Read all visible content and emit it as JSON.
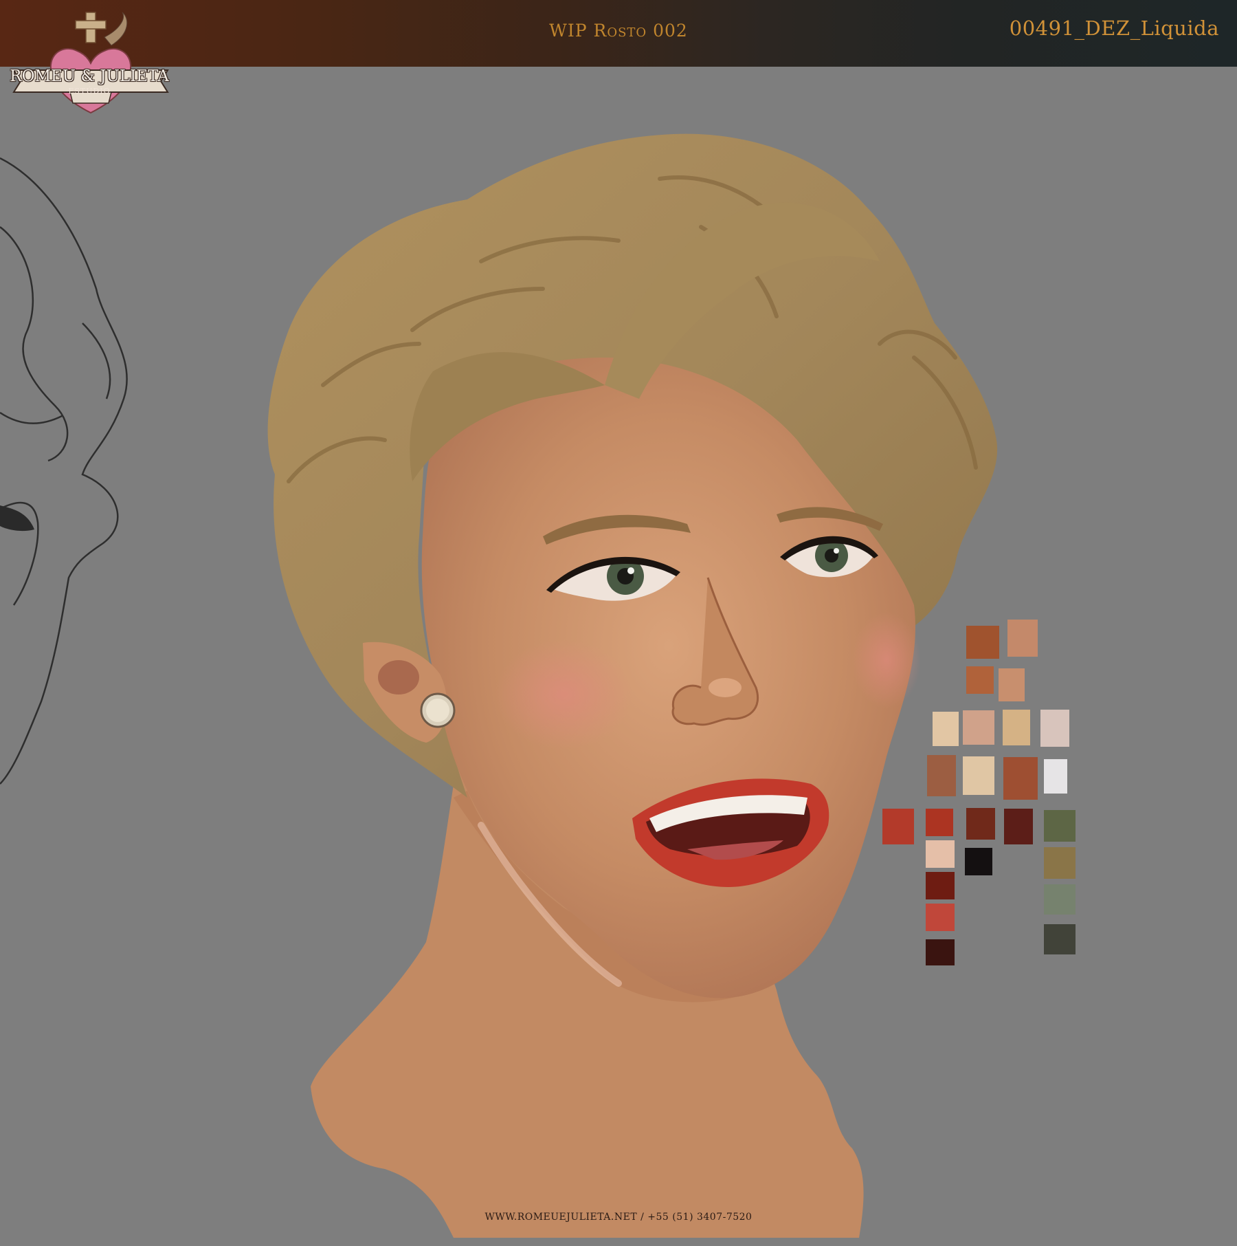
{
  "header": {
    "title": "WIP Rosto 002",
    "file_name": "00491_DEZ_Liquida"
  },
  "logo": {
    "name": "ROMEU & JULIETA",
    "sub": "ESTÚDIO",
    "icon": "sacred-heart-emblem"
  },
  "footer": {
    "contact": "WWW.ROMEUEJULIETA.NET / +55 (51) 3407-7520"
  },
  "colors": {
    "background": "#7e7e7e",
    "accent_text": "#c0852d",
    "hair": "#a8895a",
    "skin": "#c68e68",
    "lips": "#c23a2c"
  },
  "palette": [
    "#a0532e",
    "#c4896a",
    "#b0623a",
    "#c88f6e",
    "#e2c6a4",
    "#d0a28a",
    "#d5b285",
    "#d8c4bc",
    "#9c5e42",
    "#e0c6a4",
    "#9e4f32",
    "#e6e4e6",
    "#b33a2a",
    "#ac3422",
    "#70291a",
    "#5c1e18",
    "#5d6645",
    "#e5bfa8",
    "#141011",
    "#8a7548",
    "#6e1c12",
    "#76826e",
    "#c0473a",
    "#414339",
    "#3a1410"
  ]
}
